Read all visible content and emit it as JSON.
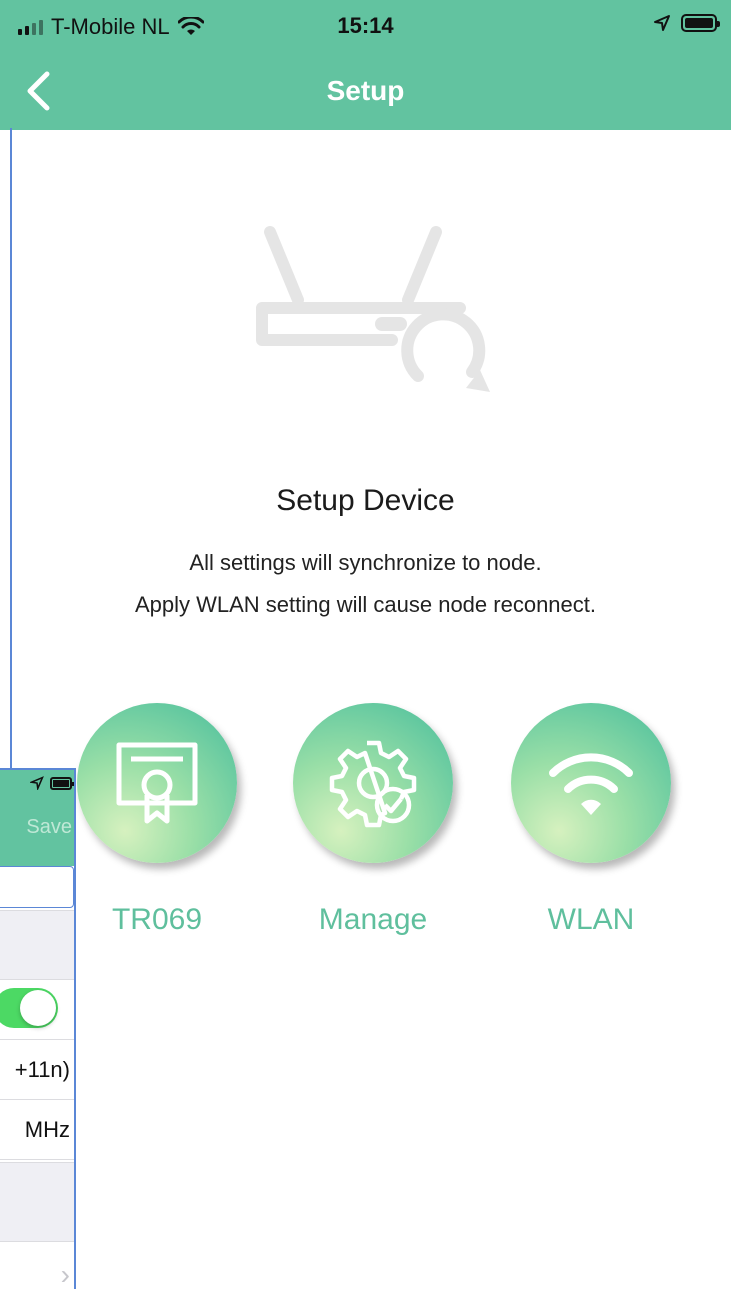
{
  "status_bar": {
    "carrier": "T-Mobile NL",
    "time": "15:14"
  },
  "nav": {
    "title": "Setup"
  },
  "content": {
    "heading": "Setup Device",
    "description_line1": "All settings will synchronize to node.",
    "description_line2": "Apply WLAN setting will cause node reconnect."
  },
  "actions": [
    {
      "label": "TR069",
      "icon": "certificate-icon"
    },
    {
      "label": "Manage",
      "icon": "gear-check-icon"
    },
    {
      "label": "WLAN",
      "icon": "wifi-icon"
    }
  ],
  "background_screen": {
    "save_label": "Save",
    "mode_value": "+11n)",
    "bandwidth_value": "MHz"
  },
  "colors": {
    "accent": "#62c3a0",
    "label": "#5fbf9d"
  }
}
